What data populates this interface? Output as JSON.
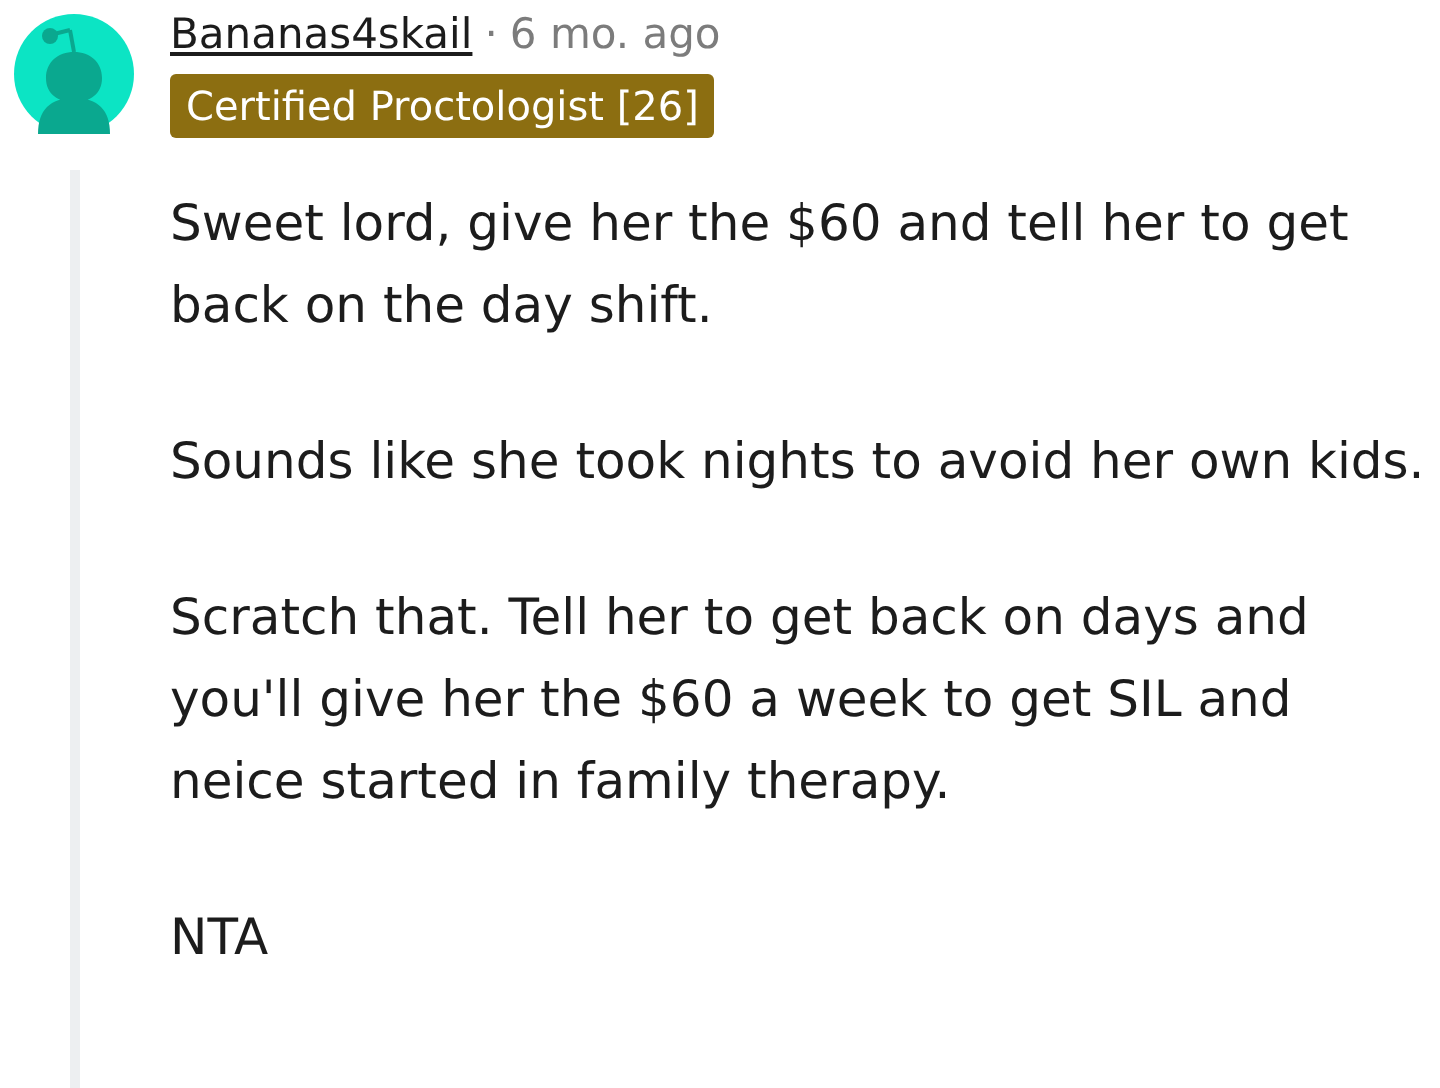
{
  "comment": {
    "author": "Bananas4skail",
    "separator": "·",
    "time": "6 mo. ago",
    "flair": {
      "text": "Certified Proctologist [26]",
      "color": "#8c6e11"
    },
    "paragraphs": [
      "Sweet lord, give her the $60 and tell her to get back on the day shift.",
      "Sounds like she took nights to avoid her own kids.",
      "Scratch that. Tell her to get back on days and you'll give her the $60 a week to get SIL and neice started in family therapy.",
      "NTA"
    ]
  }
}
